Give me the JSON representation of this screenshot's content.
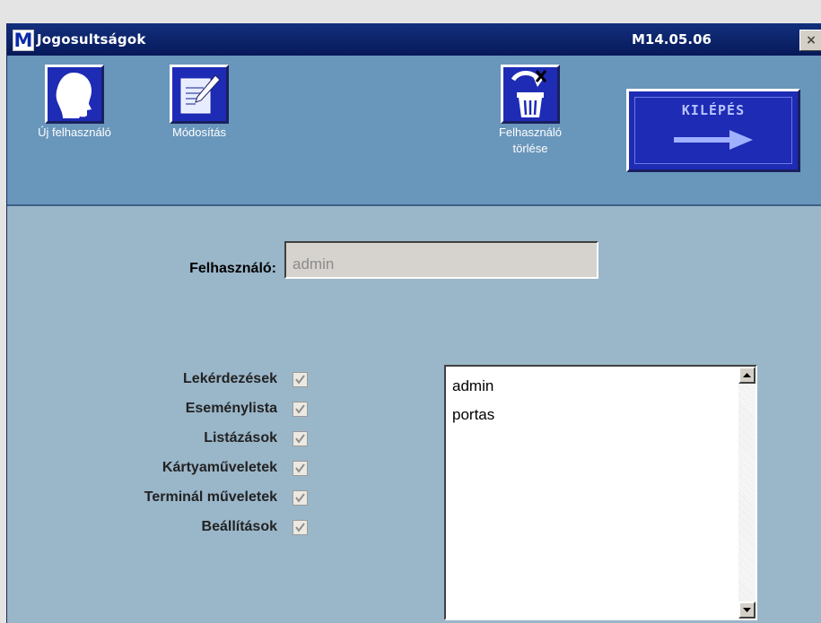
{
  "window": {
    "app_icon": "M",
    "title": "Jogosultságok",
    "version": "M14.05.06",
    "close_glyph": "×"
  },
  "toolbar": {
    "new_user_label": "Új felhasználó",
    "modify_label": "Módosítás",
    "delete_user_label": "Felhasználó törlése",
    "exit_label": "KILÉPÉS",
    "icons": [
      "head-icon",
      "edit-document-icon",
      "trash-icon",
      "arrow-right-icon"
    ]
  },
  "form": {
    "user_label": "Felhasználó:",
    "user_value": "admin"
  },
  "permissions": [
    {
      "label": "Lekérdezések",
      "checked": true
    },
    {
      "label": "Eseménylista",
      "checked": true
    },
    {
      "label": "Listázások",
      "checked": true
    },
    {
      "label": "Kártyaműveletek",
      "checked": true
    },
    {
      "label": "Terminál műveletek",
      "checked": true
    },
    {
      "label": "Beállítások",
      "checked": true
    }
  ],
  "user_list": [
    "admin",
    "portas"
  ],
  "colors": {
    "titlebar": "#0a1e6e",
    "toolbar": "#6996bb",
    "background": "#9ab6c9",
    "button": "#1e2bb5"
  }
}
